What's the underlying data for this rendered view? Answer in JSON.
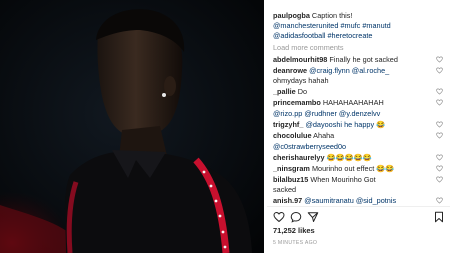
{
  "post": {
    "author": "paulpogba",
    "caption_text": "Caption this!",
    "caption_line2": "@manchesterunited #mufc #manutd",
    "caption_line3": "@adidasfootball #heretocreate",
    "load_more": "Load more comments"
  },
  "comments": [
    {
      "user": "abdelmourhit98",
      "lines": [
        "Finally he got sacked"
      ]
    },
    {
      "user": "deanrowe",
      "lines": [
        "@craig.flynn @al.roche_",
        "ohmydays hahah"
      ]
    },
    {
      "user": "_pallie",
      "lines": [
        "Do"
      ]
    },
    {
      "user": "princemambo",
      "lines": [
        "HAHAHAAHAHAH"
      ]
    },
    {
      "user": "",
      "lines": [
        "@rizo.pp @rudhner @y.denzelvv"
      ]
    },
    {
      "user": "trigzyhf_",
      "lines": [
        "@dayooshi he happy 😂"
      ]
    },
    {
      "user": "chocolulue",
      "lines": [
        "Ahaha"
      ]
    },
    {
      "user": "",
      "lines": [
        "@c0strawberryseed0o"
      ]
    },
    {
      "user": "cherishaurelyy",
      "lines": [
        "😂😂😂😂😂"
      ]
    },
    {
      "user": "_ninsgram",
      "lines": [
        "Mourinho out effect 😂😂"
      ]
    },
    {
      "user": "bilalbuz15",
      "lines": [
        "When Mourinho Got",
        "sacked"
      ]
    },
    {
      "user": "anish.97",
      "lines": [
        "@saumitranatu @sid_potnis"
      ]
    }
  ],
  "engagement": {
    "likes": "71,252 likes",
    "time": "5 MINUTES AGO"
  },
  "colors": {
    "link": "#003569",
    "muted": "#999999",
    "accent_red": "#c8102e"
  }
}
